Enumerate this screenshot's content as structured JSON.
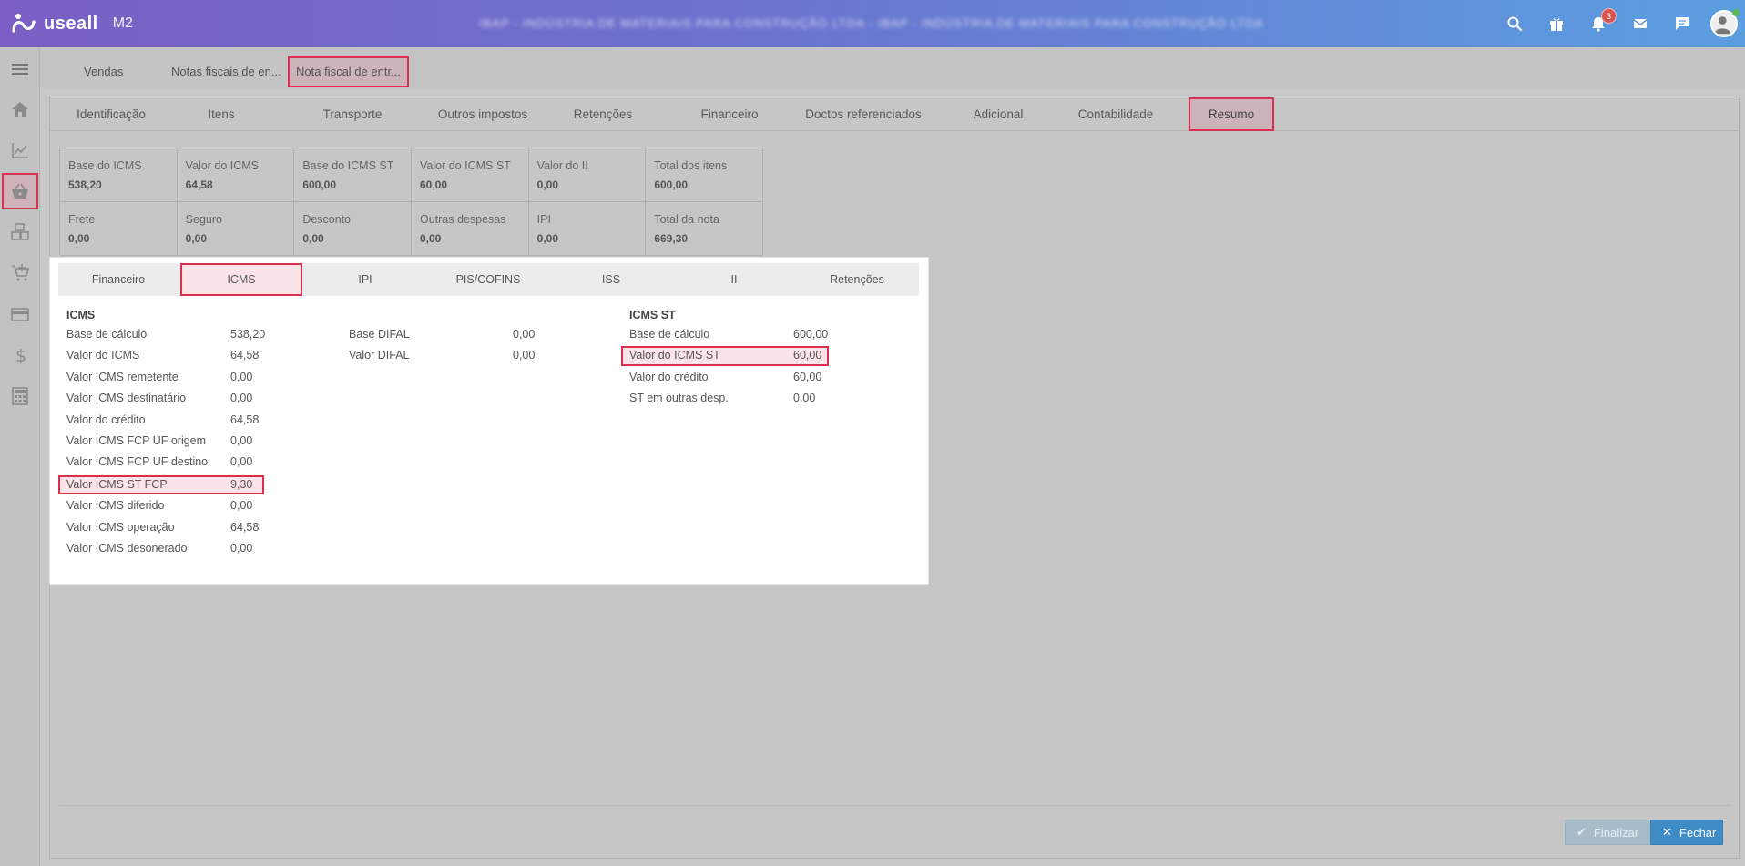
{
  "header": {
    "logo_text": "useall",
    "logo_version": "M2",
    "company_name": "IBAP - INDÚSTRIA DE MATERIAIS PARA CONSTRUÇÃO LTDA - IBAP - INDÚSTRIA DE MATERIAIS PARA CONSTRUÇÃO LTDA",
    "notifications_count": "3",
    "icons": [
      "search-icon",
      "gift-icon",
      "bell-icon",
      "mail-icon",
      "chat-icon",
      "user-avatar"
    ]
  },
  "sidebar": {
    "items": [
      "menu-icon",
      "home-icon",
      "chart-icon",
      "basket-icon",
      "boxes-icon",
      "cart-icon",
      "card-icon",
      "dollar-icon",
      "calculator-icon"
    ],
    "active": "basket-icon"
  },
  "page_tabs": [
    {
      "label": "Vendas"
    },
    {
      "label": "Notas fiscais de en..."
    },
    {
      "label": "Nota fiscal de entr..."
    }
  ],
  "section_tabs": [
    {
      "label": "Identificação"
    },
    {
      "label": "Itens"
    },
    {
      "label": "Transporte"
    },
    {
      "label": "Outros impostos"
    },
    {
      "label": "Retenções"
    },
    {
      "label": "Financeiro"
    },
    {
      "label": "Doctos referenciados"
    },
    {
      "label": "Adicional"
    },
    {
      "label": "Contabilidade"
    },
    {
      "label": "Resumo"
    }
  ],
  "summary": [
    {
      "label": "Base do ICMS",
      "value": "538,20"
    },
    {
      "label": "Valor do ICMS",
      "value": "64,58"
    },
    {
      "label": "Base do ICMS ST",
      "value": "600,00"
    },
    {
      "label": "Valor do ICMS ST",
      "value": "60,00"
    },
    {
      "label": "Valor do II",
      "value": "0,00"
    },
    {
      "label": "Total dos itens",
      "value": "600,00"
    },
    {
      "label": "Frete",
      "value": "0,00"
    },
    {
      "label": "Seguro",
      "value": "0,00"
    },
    {
      "label": "Desconto",
      "value": "0,00"
    },
    {
      "label": "Outras despesas",
      "value": "0,00"
    },
    {
      "label": "IPI",
      "value": "0,00"
    },
    {
      "label": "Total da nota",
      "value": "669,30"
    }
  ],
  "modal": {
    "tabs": [
      {
        "label": "Financeiro"
      },
      {
        "label": "ICMS"
      },
      {
        "label": "IPI"
      },
      {
        "label": "PIS/COFINS"
      },
      {
        "label": "ISS"
      },
      {
        "label": "II"
      },
      {
        "label": "Retenções"
      }
    ],
    "icms_title": "ICMS",
    "icms_rows": [
      {
        "label": "Base de cálculo",
        "value": "538,20"
      },
      {
        "label": "Valor do ICMS",
        "value": "64,58"
      },
      {
        "label": "Valor ICMS remetente",
        "value": "0,00"
      },
      {
        "label": "Valor ICMS destinatário",
        "value": "0,00"
      },
      {
        "label": "Valor do crédito",
        "value": "64,58"
      },
      {
        "label": "Valor ICMS FCP UF origem",
        "value": "0,00"
      },
      {
        "label": "Valor ICMS FCP UF destino",
        "value": "0,00"
      },
      {
        "label": "Valor ICMS ST FCP",
        "value": "9,30"
      },
      {
        "label": "Valor ICMS diferido",
        "value": "0,00"
      },
      {
        "label": "Valor ICMS operação",
        "value": "64,58"
      },
      {
        "label": "Valor ICMS desonerado",
        "value": "0,00"
      }
    ],
    "difal_rows": [
      {
        "label": "Base DIFAL",
        "value": "0,00"
      },
      {
        "label": "Valor DIFAL",
        "value": "0,00"
      }
    ],
    "st_title": "ICMS ST",
    "st_rows": [
      {
        "label": "Base de cálculo",
        "value": "600,00"
      },
      {
        "label": "Valor do ICMS ST",
        "value": "60,00"
      },
      {
        "label": "Valor do crédito",
        "value": "60,00"
      },
      {
        "label": "ST em outras desp.",
        "value": "0,00"
      }
    ]
  },
  "footer": {
    "finalizar_label": "Finalizar",
    "fechar_label": "Fechar"
  }
}
